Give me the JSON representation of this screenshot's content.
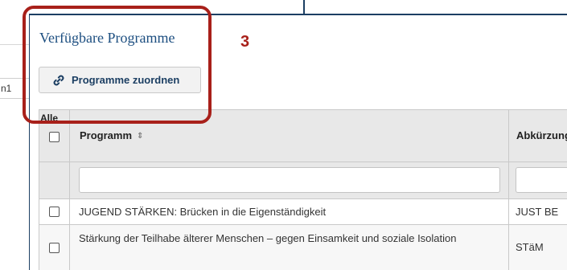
{
  "background": {
    "field_text": "n1"
  },
  "panel": {
    "title": "Verfügbare Programme",
    "assign_button": {
      "label": "Programme zuordnen",
      "icon": "link-icon"
    }
  },
  "table": {
    "headers": {
      "select_all": "Alle",
      "program": "Programm",
      "program_sort_icon": "⇕",
      "abbreviation": "Abkürzung"
    },
    "filters": {
      "program": "",
      "abbreviation": ""
    },
    "rows": [
      {
        "checked": false,
        "program": "JUGEND STÄRKEN: Brücken in die Eigenständigkeit",
        "abbreviation": "JUST BE"
      },
      {
        "checked": false,
        "program": "Stärkung der Teilhabe älterer Menschen – gegen Einsamkeit und soziale Isolation",
        "abbreviation": "STäM"
      }
    ]
  },
  "annotation": {
    "marker": "3",
    "color": "#a8201a"
  },
  "colors": {
    "accent": "#1c3f63",
    "title": "#1c4e80",
    "header_bg": "#e8e8e8"
  }
}
